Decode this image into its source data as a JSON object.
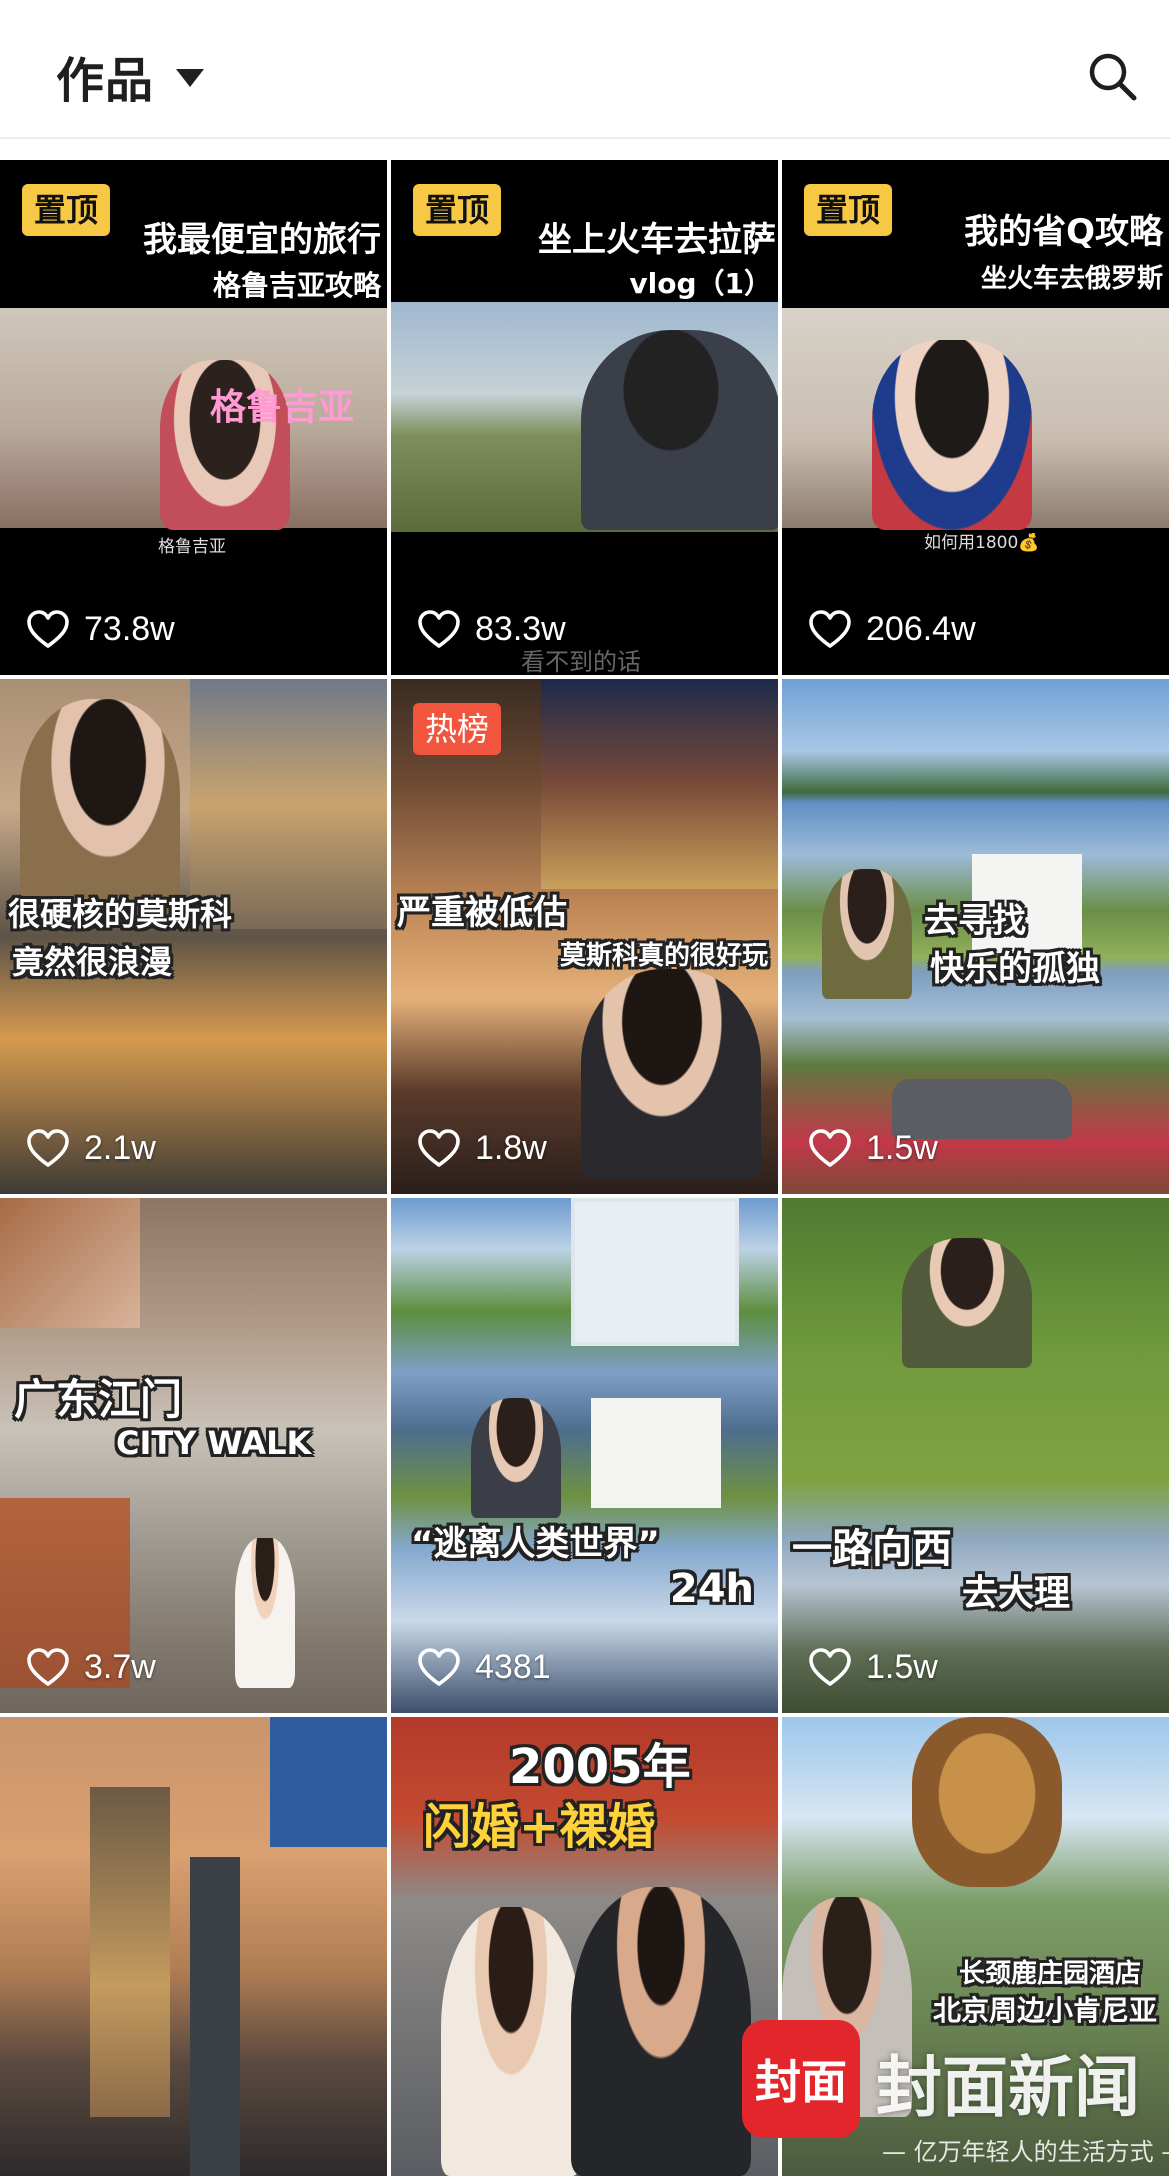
{
  "header": {
    "title": "作品",
    "caret_icon": "triangle-down-icon",
    "search_icon": "search-icon"
  },
  "tiles": [
    {
      "badge": "置顶",
      "caption_lines": [
        "我最便宜的旅行",
        "格鲁吉亚攻略"
      ],
      "overlay_text": "格鲁吉亚",
      "subtitle": "格鲁吉亚",
      "likes": "73.8w"
    },
    {
      "badge": "置顶",
      "caption_lines": [
        "坐上火车去拉萨",
        "vlog（1）"
      ],
      "subtitle": "看不到的话",
      "likes": "83.3w"
    },
    {
      "badge": "置顶",
      "caption_lines": [
        "我的省Q攻略",
        "坐火车去俄罗斯"
      ],
      "subtitle": "如何用1800💰",
      "likes": "206.4w"
    },
    {
      "caption_lines": [
        "很硬核的莫斯科",
        "竟然很浪漫"
      ],
      "likes": "2.1w"
    },
    {
      "badge": "热榜",
      "caption_lines": [
        "严重被低估",
        "莫斯科真的很好玩"
      ],
      "likes": "1.8w"
    },
    {
      "caption_lines": [
        "去寻找",
        "快乐的孤独"
      ],
      "likes": "1.5w"
    },
    {
      "caption_lines": [
        "广东江门",
        "CITY WALK"
      ],
      "likes": "3.7w"
    },
    {
      "caption_lines": [
        "“逃离人类世界”",
        "24h"
      ],
      "likes": "4381"
    },
    {
      "caption_lines": [
        "一路向西",
        "去大理"
      ],
      "likes": "1.5w"
    },
    {
      "caption_lines": []
    },
    {
      "caption_lines": [
        "2005年",
        "闪婚+裸婚"
      ]
    },
    {
      "caption_lines": [
        "长颈鹿庄园酒店",
        "北京周边小肯尼亚"
      ]
    }
  ],
  "watermark": {
    "logo": "封面",
    "name": "封面新闻",
    "slogan": "— 亿万年轻人的生活方式 —"
  }
}
